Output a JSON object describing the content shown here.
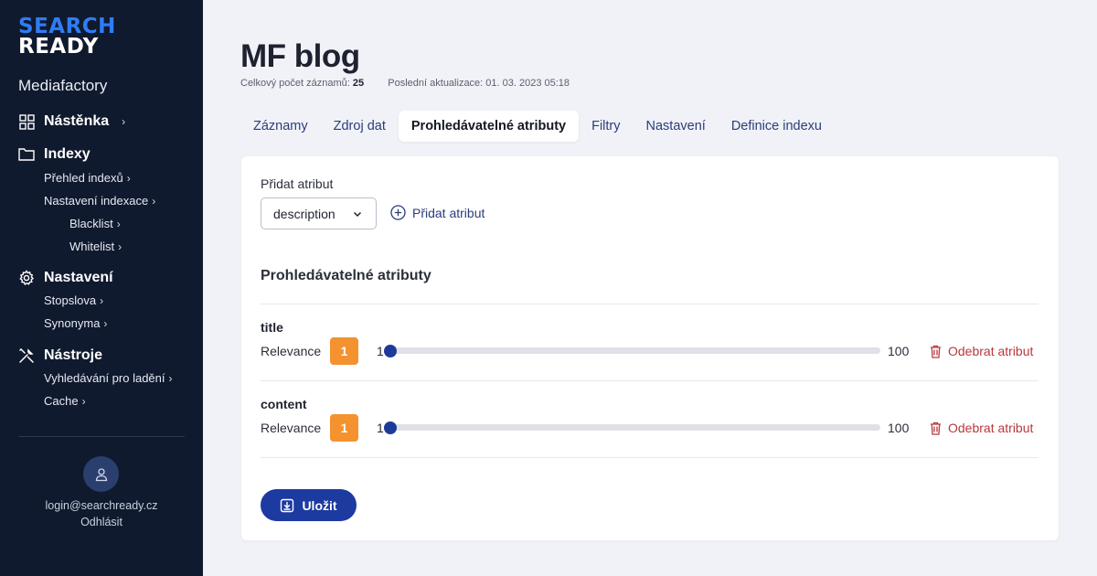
{
  "logo": {
    "line1": "SEARCH",
    "line2": "READY"
  },
  "organization": "Mediafactory",
  "sidebar": {
    "sections": [
      {
        "label": "Nástěnka",
        "icon": "dashboard-icon",
        "items": []
      },
      {
        "label": "Indexy",
        "icon": "folder-icon",
        "items": [
          {
            "label": "Přehled indexů"
          },
          {
            "label": "Nastavení indexace"
          },
          {
            "label": "Blacklist"
          },
          {
            "label": "Whitelist"
          }
        ]
      },
      {
        "label": "Nastavení",
        "icon": "gear-icon",
        "items": [
          {
            "label": "Stopslova"
          },
          {
            "label": "Synonyma"
          }
        ]
      },
      {
        "label": "Nástroje",
        "icon": "tools-icon",
        "items": [
          {
            "label": "Vyhledávání pro ladění"
          },
          {
            "label": "Cache"
          }
        ]
      }
    ],
    "user": {
      "email": "login@searchready.cz",
      "logout": "Odhlásit"
    }
  },
  "page": {
    "title": "MF blog",
    "count_label": "Celkový počet záznamů:",
    "count_value": "25",
    "updated_label": "Poslední aktualizace:",
    "updated_value": "01. 03. 2023 05:18"
  },
  "tabs": [
    {
      "label": "Záznamy",
      "active": false
    },
    {
      "label": "Zdroj dat",
      "active": false
    },
    {
      "label": "Prohledávatelné atributy",
      "active": true
    },
    {
      "label": "Filtry",
      "active": false
    },
    {
      "label": "Nastavení",
      "active": false
    },
    {
      "label": "Definice indexu",
      "active": false
    }
  ],
  "form": {
    "add_label": "Přidat atribut",
    "select_value": "description",
    "add_button": "Přidat atribut",
    "section_title": "Prohledávatelné atributy",
    "attributes": [
      {
        "name": "title",
        "relevance_label": "Relevance",
        "relevance": "1",
        "min": "1",
        "max": "100",
        "remove": "Odebrat atribut"
      },
      {
        "name": "content",
        "relevance_label": "Relevance",
        "relevance": "1",
        "min": "1",
        "max": "100",
        "remove": "Odebrat atribut"
      }
    ],
    "save_button": "Uložit"
  },
  "colors": {
    "sidebar_bg": "#101a2e",
    "accent": "#1c3aa0",
    "badge": "#f3922e",
    "danger": "#b8383c",
    "logo_blue": "#2f7cf6"
  }
}
